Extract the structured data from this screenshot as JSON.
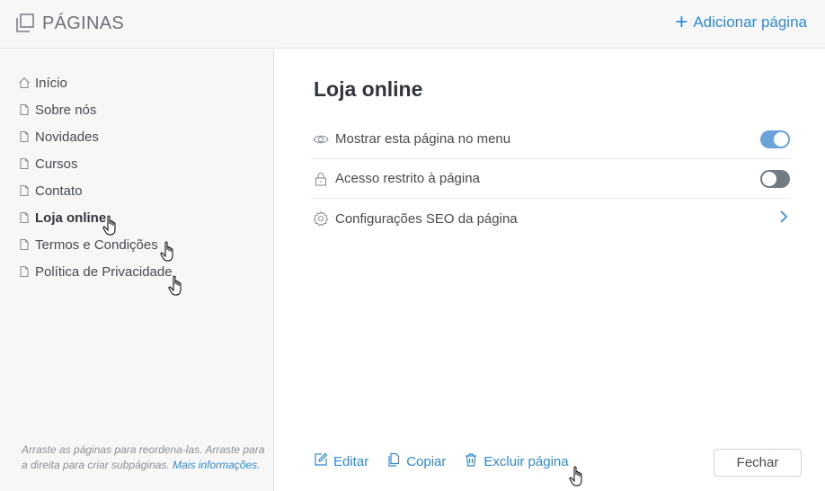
{
  "header": {
    "title": "PÁGINAS",
    "add_label": "Adicionar página",
    "accent": "#2e8ad8"
  },
  "sidebar": {
    "items": [
      {
        "label": "Início",
        "icon": "home-icon",
        "active": false
      },
      {
        "label": "Sobre nós",
        "icon": "page-icon",
        "active": false
      },
      {
        "label": "Novidades",
        "icon": "page-icon",
        "active": false
      },
      {
        "label": "Cursos",
        "icon": "page-icon",
        "active": false
      },
      {
        "label": "Contato",
        "icon": "page-icon",
        "active": false
      },
      {
        "label": "Loja online",
        "icon": "page-icon",
        "active": true
      },
      {
        "label": "Termos e Condições",
        "icon": "page-icon",
        "active": false
      },
      {
        "label": "Política de Privacidade",
        "icon": "page-icon",
        "active": false
      }
    ],
    "hint_text": "Arraste as páginas para reordena-las. Arraste para a direita para criar subpáginas.",
    "hint_link": "Mais informações."
  },
  "main": {
    "page_title": "Loja online",
    "options": [
      {
        "label": "Mostrar esta página no menu",
        "icon": "eye-icon",
        "control": "toggle",
        "value": true
      },
      {
        "label": "Acesso restrito à página",
        "icon": "lock-icon",
        "control": "toggle",
        "value": false
      },
      {
        "label": "Configurações SEO da página",
        "icon": "gear-icon",
        "control": "chevron-right-icon"
      }
    ],
    "actions": {
      "edit": "Editar",
      "copy": "Copiar",
      "delete": "Excluir página"
    },
    "close_label": "Fechar"
  }
}
